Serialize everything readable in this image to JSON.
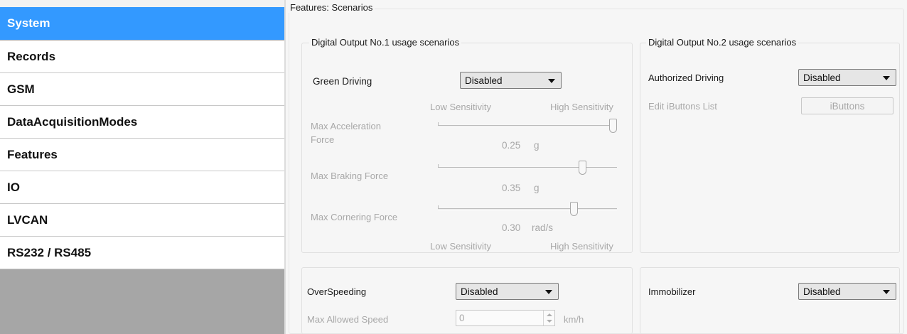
{
  "sidebar": {
    "items": [
      {
        "label": "System",
        "active": true
      },
      {
        "label": "Records"
      },
      {
        "label": "GSM"
      },
      {
        "label": "DataAcquisitionModes"
      },
      {
        "label": "Features"
      },
      {
        "label": "IO"
      },
      {
        "label": "LVCAN"
      },
      {
        "label": "RS232 / RS485"
      }
    ]
  },
  "main": {
    "section_title": "Features: Scenarios",
    "do1": {
      "title": "Digital Output No.1 usage scenarios",
      "green_driving_label": "Green Driving",
      "green_driving_value": "Disabled",
      "low_sensitivity": "Low Sensitivity",
      "high_sensitivity": "High Sensitivity",
      "accel_label_1": "Max Acceleration",
      "accel_label_2": "Force",
      "accel_value": "0.25",
      "accel_unit": "g",
      "accel_level": 1.0,
      "braking_label": "Max Braking Force",
      "braking_value": "0.35",
      "braking_unit": "g",
      "braking_level": 0.82,
      "cornering_label": "Max Cornering Force",
      "cornering_value": "0.30",
      "cornering_unit": "rad/s",
      "cornering_level": 0.77,
      "low_sensitivity_bottom": "Low Sensitivity",
      "high_sensitivity_bottom": "High Sensitivity"
    },
    "do2": {
      "title": "Digital Output No.2 usage scenarios",
      "authorized_label": "Authorized Driving",
      "authorized_value": "Disabled",
      "ibuttons_label": "Edit iButtons List",
      "ibuttons_button": "iButtons"
    },
    "overspeeding": {
      "label": "OverSpeeding",
      "value": "Disabled",
      "max_speed_label": "Max Allowed Speed",
      "max_speed_value": "0",
      "unit": "km/h"
    },
    "immobilizer": {
      "label": "Immobilizer",
      "value": "Disabled"
    }
  },
  "colors": {
    "active_nav": "#3399ff",
    "sidebar_bg": "#a6a6a6",
    "panel_bg": "#f6f6f6",
    "disabled_text": "#a8a8a8"
  }
}
